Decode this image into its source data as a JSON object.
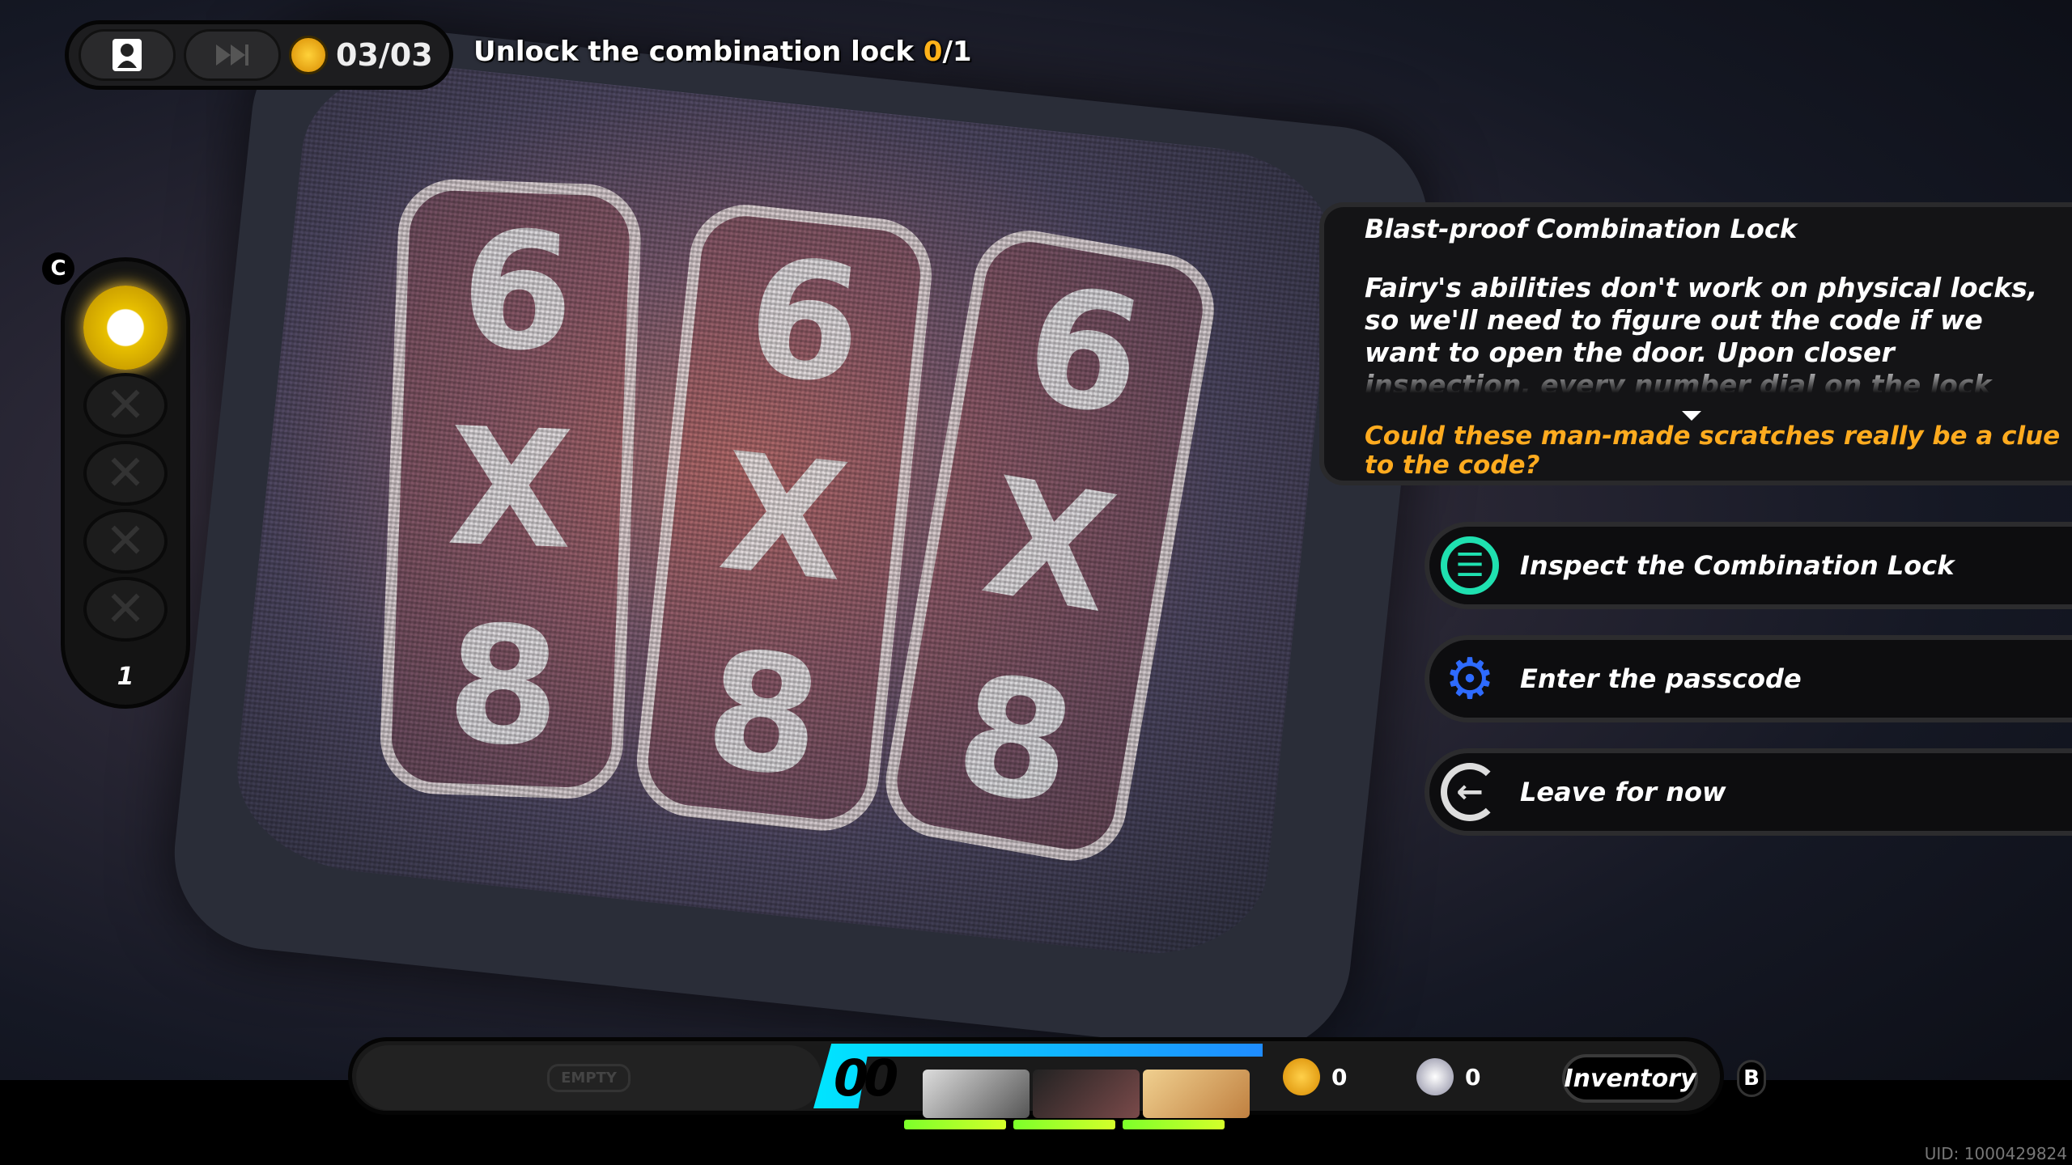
{
  "scene": {
    "dials": [
      [
        "6",
        "X",
        "8"
      ],
      [
        "6",
        "X",
        "8"
      ],
      [
        "6",
        "X",
        "8"
      ]
    ]
  },
  "topbar": {
    "profile_icon": "person-icon",
    "skip_icon": "fast-forward-icon",
    "progress_icon": "gold-coin-icon",
    "progress": "03/03"
  },
  "quest": {
    "text": "Unlock the combination lock",
    "current": "0",
    "total": "/1",
    "highlight_color": "#ffb21a"
  },
  "left_panel": {
    "hotkey": "C",
    "slots_empty": 4,
    "count": "1",
    "empty_slot_glyph": "✕"
  },
  "dialog": {
    "title": "Blast-proof Combination Lock",
    "body": "Fairy's abilities don't work on physical locks, so we'll need to figure out the code if we want to open the door. Upon closer inspection, every number dial on the lock has some markings etched into",
    "hint": "Could these man-made scratches really be a clue to the code?",
    "hint_color": "#ffab1f"
  },
  "options": [
    {
      "label": "Inspect the Combination Lock",
      "icon": "inspect-list-icon",
      "glyph": "☰",
      "color": "#1fe0b0"
    },
    {
      "label": "Enter the passcode",
      "icon": "dial-gear-icon",
      "glyph": "⚙",
      "color": "#2e6bff"
    },
    {
      "label": "Leave for now",
      "icon": "exit-arrow-icon",
      "glyph": "←",
      "color": "#dddddd"
    }
  ],
  "bottom": {
    "empty_label": "EMPTY",
    "team_number": "00",
    "party": [
      {
        "name": "member-1"
      },
      {
        "name": "member-2"
      },
      {
        "name": "member-3"
      }
    ],
    "gold": "0",
    "silver": "0",
    "inventory_label": "Inventory",
    "inventory_key": "B",
    "team_color": "#00e5ff"
  },
  "uid": "UID: 1000429824"
}
